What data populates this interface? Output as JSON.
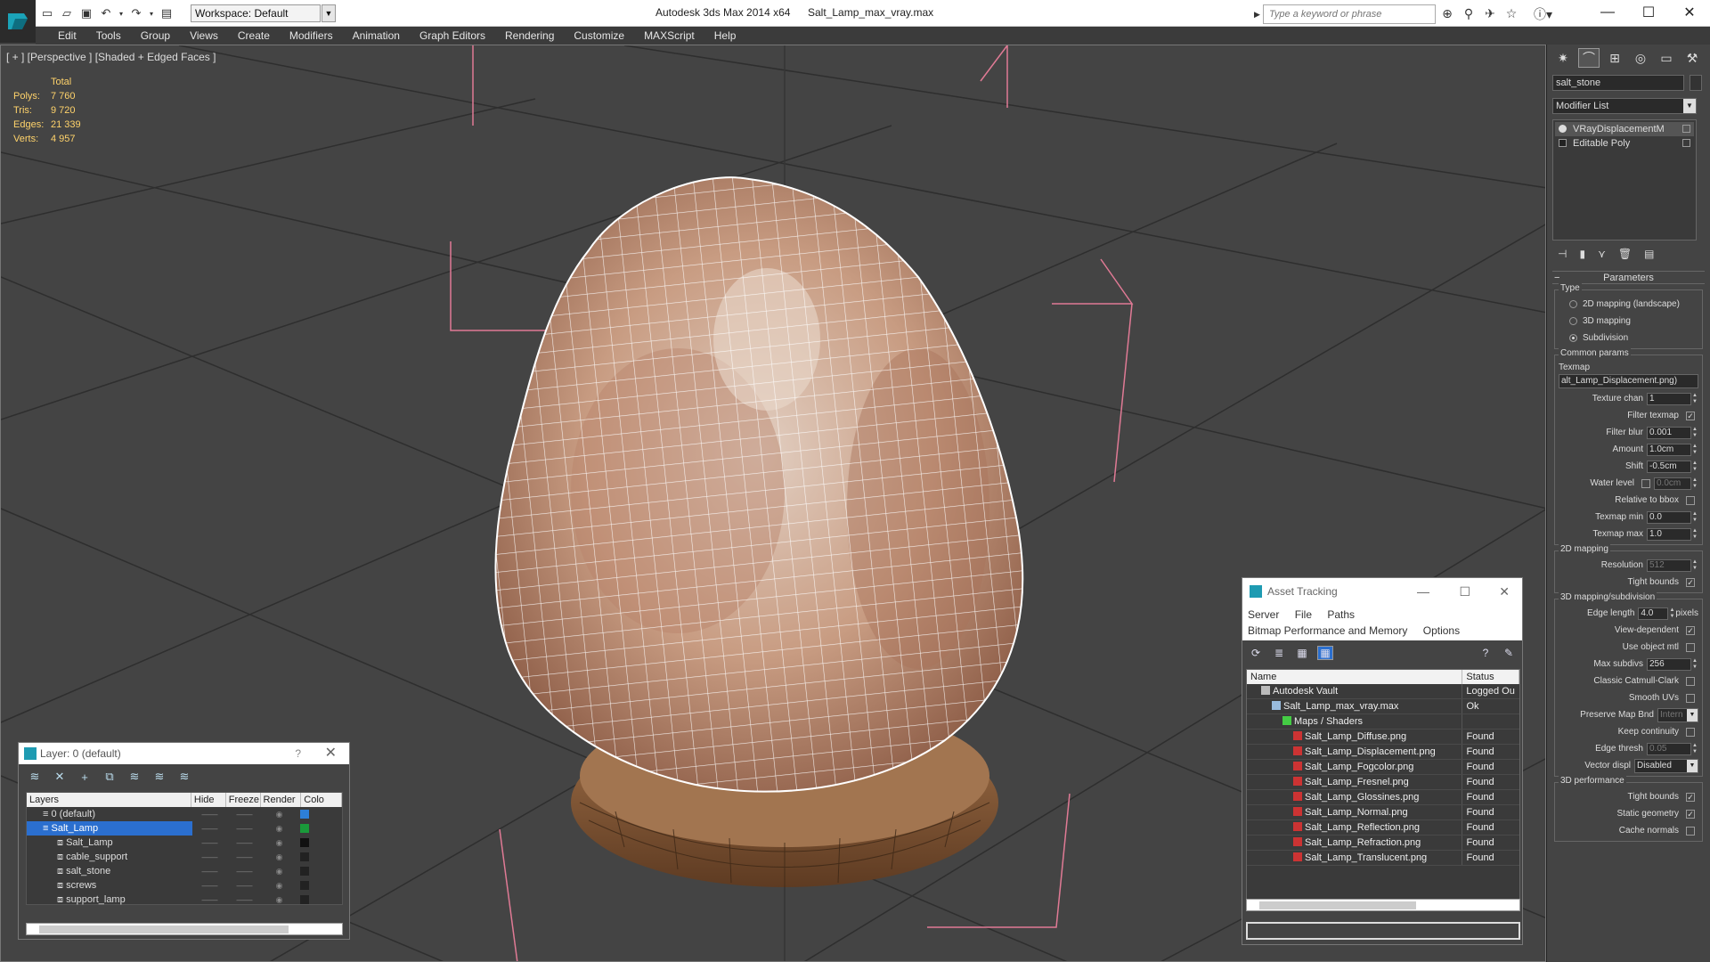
{
  "titlebar": {
    "app_title": "Autodesk 3ds Max  2014 x64",
    "file_name": "Salt_Lamp_max_vray.max",
    "workspace": "Workspace: Default",
    "search_placeholder": "Type a keyword or phrase"
  },
  "menu": [
    "Edit",
    "Tools",
    "Group",
    "Views",
    "Create",
    "Modifiers",
    "Animation",
    "Graph Editors",
    "Rendering",
    "Customize",
    "MAXScript",
    "Help"
  ],
  "viewport": {
    "label": "[ + ] [Perspective ] [Shaded + Edged Faces ]",
    "stats_header": "Total",
    "stats": [
      {
        "k": "Polys:",
        "v": "7 760"
      },
      {
        "k": "Tris:",
        "v": "9 720"
      },
      {
        "k": "Edges:",
        "v": "21 339"
      },
      {
        "k": "Verts:",
        "v": "4 957"
      }
    ]
  },
  "layer_dialog": {
    "title": "Layer: 0 (default)",
    "help": "?",
    "columns": [
      "Layers",
      "Hide",
      "Freeze",
      "Render",
      "Colo"
    ],
    "rows": [
      {
        "name": "0 (default)",
        "color": "#2d7fd8",
        "selected": false,
        "indent": 1
      },
      {
        "name": "Salt_Lamp",
        "color": "#1a9a3a",
        "selected": true,
        "indent": 1
      },
      {
        "name": "Salt_Lamp",
        "color": "#111111",
        "selected": false,
        "indent": 2
      },
      {
        "name": "cable_support",
        "color": "#222222",
        "selected": false,
        "indent": 2
      },
      {
        "name": "salt_stone",
        "color": "#222222",
        "selected": false,
        "indent": 2
      },
      {
        "name": "screws",
        "color": "#222222",
        "selected": false,
        "indent": 2
      },
      {
        "name": "support_lamp",
        "color": "#222222",
        "selected": false,
        "indent": 2
      }
    ]
  },
  "asset_tracking": {
    "title": "Asset Tracking",
    "menu_row1": [
      "Server",
      "File",
      "Paths"
    ],
    "menu_row2": [
      "Bitmap Performance and Memory",
      "Options"
    ],
    "columns": [
      "Name",
      "Status"
    ],
    "rows": [
      {
        "name": "Autodesk Vault",
        "status": "Logged Ou",
        "indent": 1
      },
      {
        "name": "Salt_Lamp_max_vray.max",
        "status": "Ok",
        "indent": 2
      },
      {
        "name": "Maps / Shaders",
        "status": "",
        "indent": 3
      },
      {
        "name": "Salt_Lamp_Diffuse.png",
        "status": "Found",
        "indent": 4
      },
      {
        "name": "Salt_Lamp_Displacement.png",
        "status": "Found",
        "indent": 4
      },
      {
        "name": "Salt_Lamp_Fogcolor.png",
        "status": "Found",
        "indent": 4
      },
      {
        "name": "Salt_Lamp_Fresnel.png",
        "status": "Found",
        "indent": 4
      },
      {
        "name": "Salt_Lamp_Glossines.png",
        "status": "Found",
        "indent": 4
      },
      {
        "name": "Salt_Lamp_Normal.png",
        "status": "Found",
        "indent": 4
      },
      {
        "name": "Salt_Lamp_Reflection.png",
        "status": "Found",
        "indent": 4
      },
      {
        "name": "Salt_Lamp_Refraction.png",
        "status": "Found",
        "indent": 4
      },
      {
        "name": "Salt_Lamp_Translucent.png",
        "status": "Found",
        "indent": 4
      }
    ]
  },
  "command_panel": {
    "object_name": "salt_stone",
    "modifier_list": "Modifier List",
    "stack": [
      "VRayDisplacementM",
      "Editable Poly"
    ],
    "rollout_title": "Parameters",
    "type_group": "Type",
    "type_options": [
      {
        "label": "2D mapping (landscape)",
        "on": false
      },
      {
        "label": "3D mapping",
        "on": false
      },
      {
        "label": "Subdivision",
        "on": true
      }
    ],
    "common_group": "Common params",
    "texmap_label": "Texmap",
    "texmap_value": "alt_Lamp_Displacement.png)",
    "texture_chan_label": "Texture chan",
    "texture_chan": "1",
    "filter_texmap": "Filter texmap",
    "filter_blur_label": "Filter blur",
    "filter_blur": "0.001",
    "amount_label": "Amount",
    "amount": "1.0cm",
    "shift_label": "Shift",
    "shift": "-0.5cm",
    "water_label": "Water level",
    "water": "0.0cm",
    "relative_bbox": "Relative to bbox",
    "texmap_min_label": "Texmap min",
    "texmap_min": "0.0",
    "texmap_max_label": "Texmap max",
    "texmap_max": "1.0",
    "mapping2d_group": "2D mapping",
    "resolution_label": "Resolution",
    "resolution": "512",
    "tight_bounds_label": "Tight bounds",
    "mapping3d_group": "3D mapping/subdivision",
    "edge_length_label": "Edge length",
    "edge_length": "4.0",
    "pixels": "pixels",
    "view_dependent": "View-dependent",
    "use_object_mtl": "Use object mtl",
    "max_subdivs_label": "Max subdivs",
    "max_subdivs": "256",
    "classic_cc": "Classic Catmull-Clark",
    "smooth_uvs": "Smooth UVs",
    "preserve_label": "Preserve Map Bnd",
    "preserve_value": "Intern",
    "keep_continuity": "Keep continuity",
    "edge_thresh_label": "Edge thresh",
    "edge_thresh": "0.05",
    "vector_disp_label": "Vector displ",
    "vector_disp": "Disabled",
    "perf_group": "3D performance",
    "perf_tight_bounds": "Tight bounds",
    "static_geometry": "Static geometry",
    "cache_normals": "Cache normals"
  }
}
